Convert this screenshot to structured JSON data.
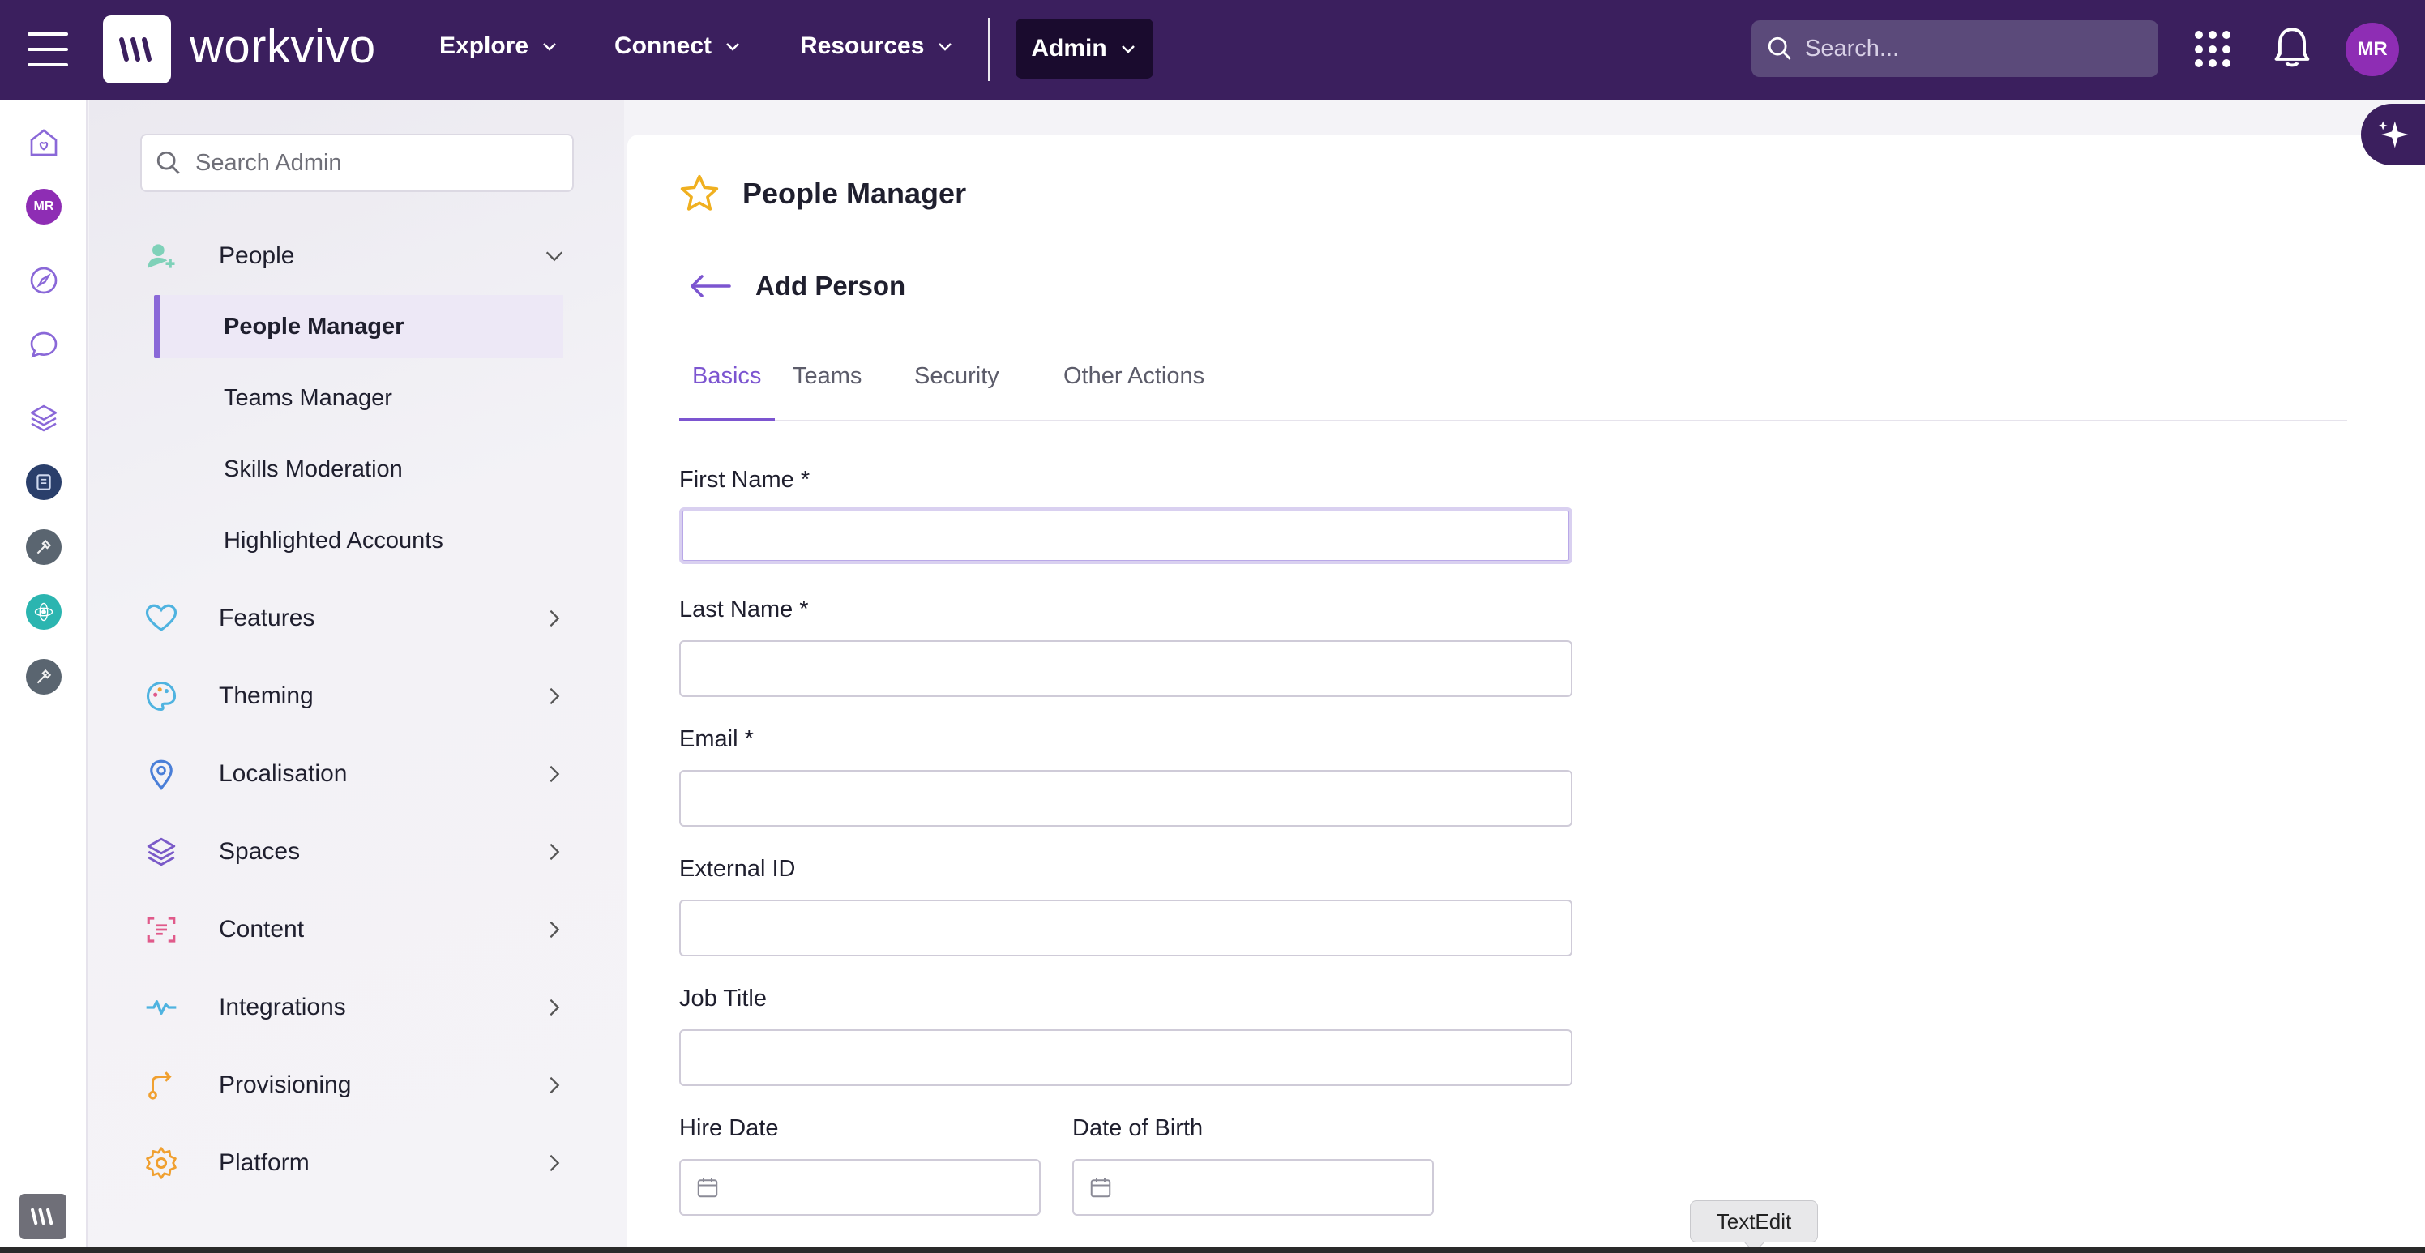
{
  "topbar": {
    "brand": "workvivo",
    "nav": [
      {
        "label": "Explore"
      },
      {
        "label": "Connect"
      },
      {
        "label": "Resources"
      }
    ],
    "admin_label": "Admin",
    "search_placeholder": "Search...",
    "avatar_initials": "MR",
    "bg_color": "#3b1f5e"
  },
  "rail": {
    "avatar_initials": "MR"
  },
  "sidebar": {
    "search_placeholder": "Search Admin",
    "sections": [
      {
        "label": "People",
        "icon": "add-person-icon",
        "expanded": true
      },
      {
        "label": "Features",
        "icon": "heart-icon"
      },
      {
        "label": "Theming",
        "icon": "palette-icon"
      },
      {
        "label": "Localisation",
        "icon": "location-pin-icon"
      },
      {
        "label": "Spaces",
        "icon": "layers-icon"
      },
      {
        "label": "Content",
        "icon": "content-scan-icon"
      },
      {
        "label": "Integrations",
        "icon": "pulse-icon"
      },
      {
        "label": "Provisioning",
        "icon": "route-icon"
      },
      {
        "label": "Platform",
        "icon": "gear-icon"
      }
    ],
    "people_items": [
      {
        "label": "People Manager",
        "active": true
      },
      {
        "label": "Teams Manager"
      },
      {
        "label": "Skills Moderation"
      },
      {
        "label": "Highlighted Accounts"
      }
    ]
  },
  "main": {
    "page_title": "People Manager",
    "sub_title": "Add Person",
    "tabs": [
      {
        "label": "Basics",
        "active": true
      },
      {
        "label": "Teams"
      },
      {
        "label": "Security"
      },
      {
        "label": "Other Actions"
      }
    ],
    "fields": {
      "first_name": "First Name *",
      "last_name": "Last Name *",
      "email": "Email *",
      "external_id": "External ID",
      "job_title": "Job Title",
      "hire_date": "Hire Date",
      "date_of_birth": "Date of Birth"
    },
    "accent_color": "#7c55d0"
  },
  "tooltip": "TextEdit"
}
